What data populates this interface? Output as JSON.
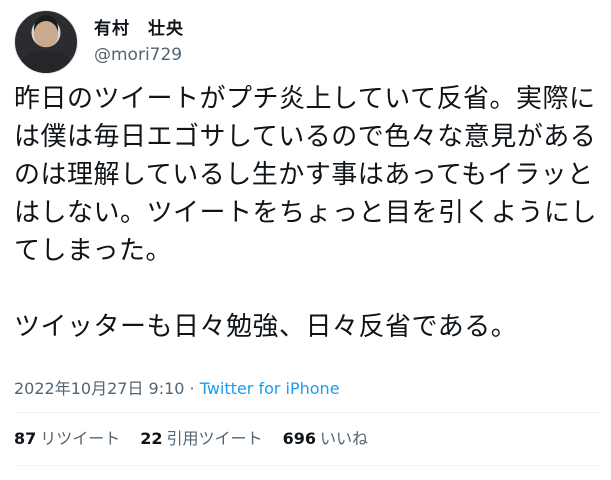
{
  "author": {
    "display_name": "有村　壮央",
    "handle": "@mori729",
    "avatar_icon": "profile-photo"
  },
  "tweet": {
    "text": "昨日のツイートがプチ炎上していて反省。実際には僕は毎日エゴサしているので色々な意見があるのは理解しているし生かす事はあってもイラッとはしない。ツイートをちょっと目を引くようにしてしまった。\n\nツイッターも日々勉強、日々反省である。",
    "timestamp": "2022年10月27日 9:10",
    "separator": " · ",
    "source": "Twitter for iPhone"
  },
  "stats": {
    "retweets": {
      "count": "87",
      "label": "リツイート"
    },
    "quotes": {
      "count": "22",
      "label": "引用ツイート"
    },
    "likes": {
      "count": "696",
      "label": "いいね"
    }
  },
  "colors": {
    "text": "#0f1419",
    "secondary": "#536471",
    "link": "#1d9bf0",
    "divider": "#eff3f4"
  }
}
